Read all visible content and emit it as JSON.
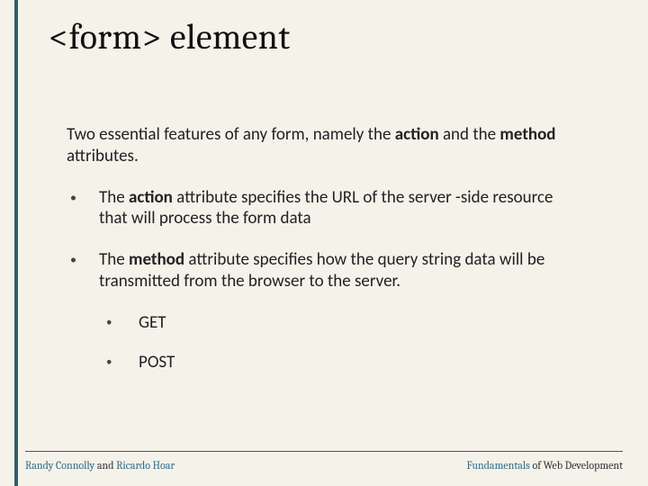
{
  "title": "<form> element",
  "intro": {
    "t1": "Two essential features of any form, namely the ",
    "b1": "action",
    "t2": " and the ",
    "b2": "method",
    "t3": " attributes."
  },
  "bullets": [
    {
      "t1": "The ",
      "b1": "action",
      "t2": " attribute specifies the URL of the server -side resource that will process the form data"
    },
    {
      "t1": "The ",
      "b1": "method",
      "t2": " attribute specifies how the query string data will be transmitted from the browser to the server."
    }
  ],
  "subitems": [
    "GET",
    "POST"
  ],
  "footer": {
    "left_author1": "Randy Connolly",
    "left_and": " and ",
    "left_author2": "Ricardo Hoar",
    "right_accent": "Fundamentals",
    "right_rest": " of Web Development"
  }
}
